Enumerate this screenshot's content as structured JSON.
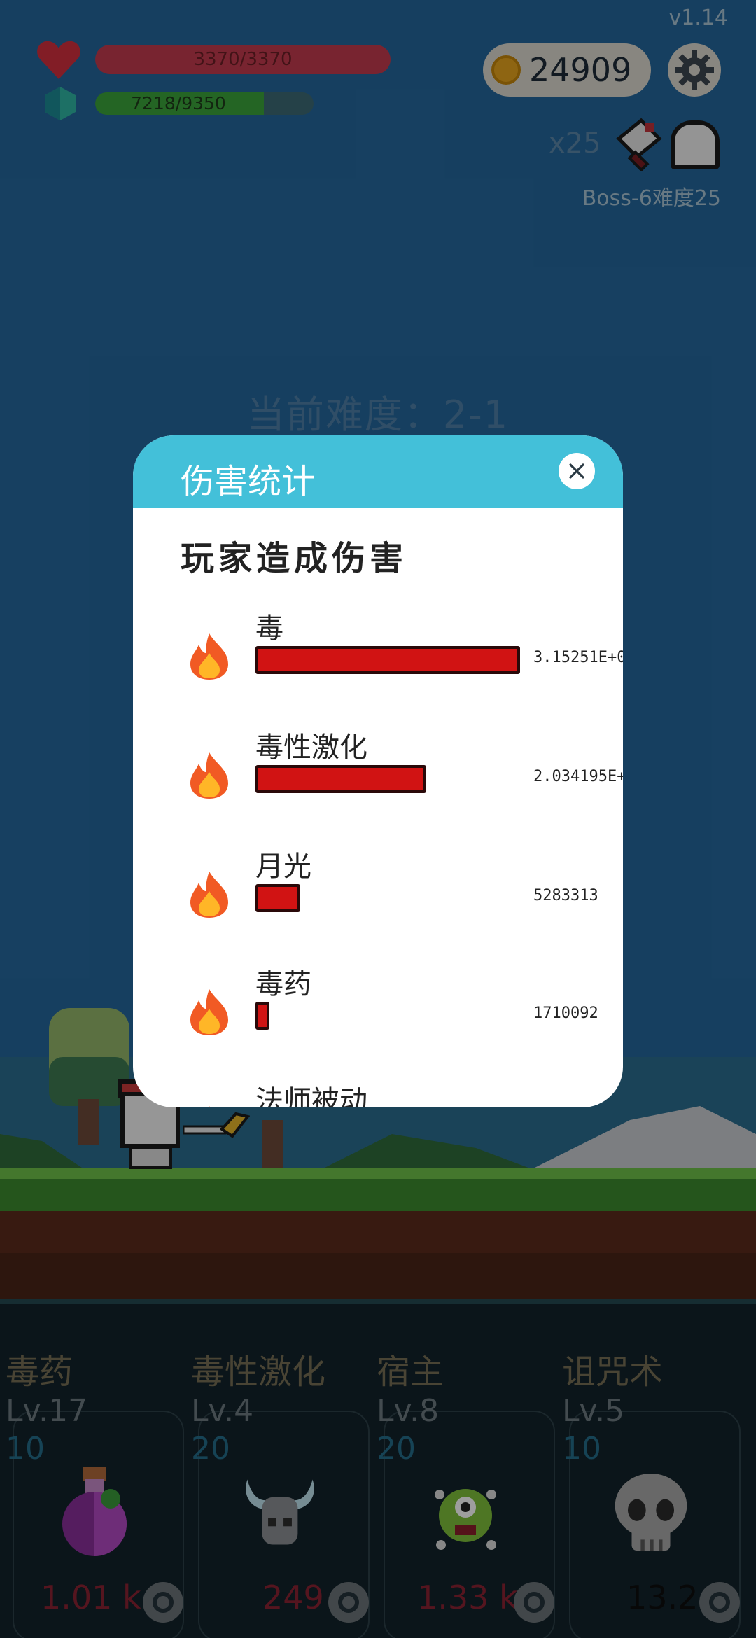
{
  "hud": {
    "version": "v1.14",
    "hp_text": "3370/3370",
    "mp_text": "7218/9350",
    "mp_fraction": 0.772,
    "coins": "24909",
    "multiplier": "x25",
    "boss_text": "Boss-6难度25",
    "difficulty_text": "当前难度：2-1",
    "icons": [
      "heart-icon",
      "gem-icon",
      "coin-icon",
      "gear-icon",
      "cleaver-icon",
      "ghost-icon"
    ]
  },
  "modal": {
    "title": "伤害统计",
    "section_title": "玩家造成伤害",
    "rows": [
      {
        "label": "毒",
        "value": "3.15251E+0",
        "fraction": 1.0
      },
      {
        "label": "毒性激化",
        "value": "2.034195E+",
        "fraction": 0.645
      },
      {
        "label": "月光",
        "value": "5283313",
        "fraction": 0.168
      },
      {
        "label": "毒药",
        "value": "1710092",
        "fraction": 0.054
      },
      {
        "label": "法师被动",
        "value": "",
        "fraction": 0.0
      }
    ]
  },
  "skills": [
    {
      "name": "毒药",
      "level": "Lv.17",
      "cost": "10",
      "damage": "1.01 k"
    },
    {
      "name": "毒性激化",
      "level": "Lv.4",
      "cost": "20",
      "damage": "249"
    },
    {
      "name": "宿主",
      "level": "Lv.8",
      "cost": "20",
      "damage": "1.33 k"
    },
    {
      "name": "诅咒术",
      "level": "Lv.5",
      "cost": "10",
      "damage": "13.2"
    }
  ],
  "colors": {
    "modal_header": "#43c0d9",
    "damage_bar": "#d11313",
    "hp_bar": "#c23b4e",
    "mp_bar": "#3aa33a"
  }
}
